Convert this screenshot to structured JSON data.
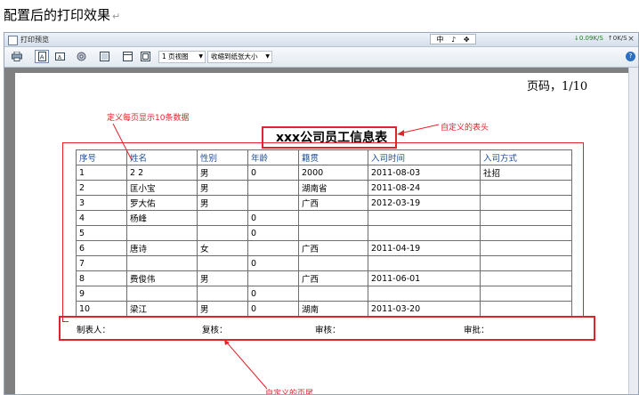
{
  "caption": {
    "text": "配置后的打印效果",
    "mark": "↵"
  },
  "window": {
    "title": "打印预览",
    "ime": [
      "中",
      "♪",
      "✥"
    ],
    "speed_down": "0.09K/S",
    "speed_up": "0K/S",
    "close_glyph": "×"
  },
  "toolbar": {
    "view_select": "1 页视图",
    "zoom_select": "收缩到纸张大小",
    "help": "?"
  },
  "report": {
    "page_label": "页码，1/10",
    "title": "xxx公司员工信息表",
    "columns": [
      "序号",
      "姓名",
      "性别",
      "年龄",
      "籍贯",
      "入司时间",
      "入司方式"
    ],
    "rows": [
      [
        "1",
        "2 2",
        "男",
        "0",
        "2000",
        "2011-08-03",
        "社招"
      ],
      [
        "2",
        "匡小宝",
        "男",
        "",
        "湖南省",
        "2011-08-24",
        ""
      ],
      [
        "3",
        "罗大佑",
        "男",
        "",
        "广西",
        "2012-03-19",
        ""
      ],
      [
        "4",
        "杨峰",
        "",
        "0",
        "",
        "",
        ""
      ],
      [
        "5",
        "",
        "",
        "0",
        "",
        "",
        ""
      ],
      [
        "6",
        "唐诗",
        "女",
        "",
        "广西",
        "2011-04-19",
        ""
      ],
      [
        "7",
        "",
        "",
        "0",
        "",
        "",
        ""
      ],
      [
        "8",
        "费俊伟",
        "男",
        "",
        "广西",
        "2011-06-01",
        ""
      ],
      [
        "9",
        "",
        "",
        "0",
        "",
        "",
        ""
      ],
      [
        "10",
        "梁江",
        "男",
        "0",
        "湖南",
        "2011-03-20",
        ""
      ]
    ],
    "footer": [
      "制表人：",
      "复核：",
      "审核：",
      "审批："
    ]
  },
  "annotations": {
    "rows_per_page": "定义每页显示10条数据",
    "custom_header": "自定义的表头",
    "custom_footer": "自定义的页尾"
  },
  "colors": {
    "annotation": "#e0242b",
    "header_text": "#1f4e9c"
  }
}
